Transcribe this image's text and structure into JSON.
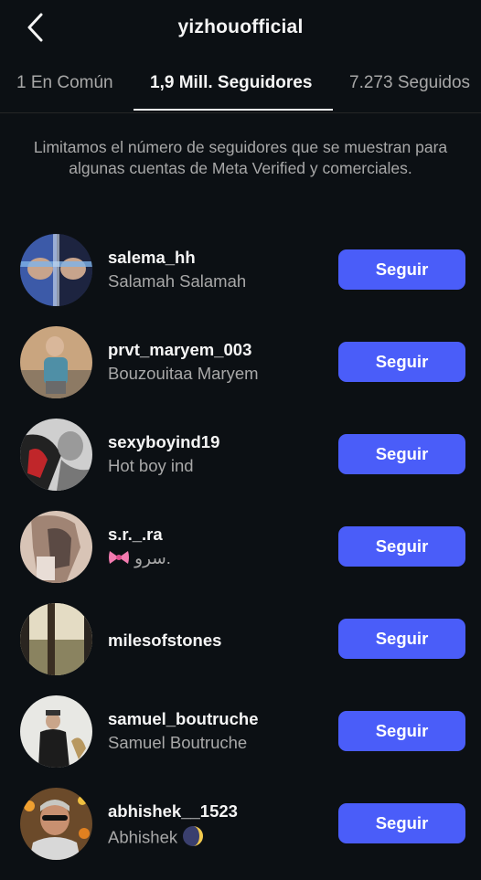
{
  "header": {
    "title": "yizhouofficial",
    "back_icon": "chevron-left-icon"
  },
  "tabs": [
    {
      "label": "1 En Común",
      "active": false
    },
    {
      "label": "1,9 Mill. Seguidores",
      "active": true
    },
    {
      "label": "7.273 Seguidos",
      "active": false
    }
  ],
  "notice": "Limitamos el número de seguidores que se muestran para algunas cuentas de Meta Verified y comerciales.",
  "followers": [
    {
      "username": "salema_hh",
      "full_name": "Salamah Salamah",
      "button": "Seguir"
    },
    {
      "username": "prvt_maryem_003",
      "full_name": "Bouzouitaa Maryem",
      "button": "Seguir"
    },
    {
      "username": "sexyboyind19",
      "full_name": "Hot boy ind",
      "button": "Seguir"
    },
    {
      "username": "s.r._.ra",
      "full_name": "سرو.",
      "full_name_emoji": "ribbon-icon",
      "button": "Seguir"
    },
    {
      "username": "milesofstones",
      "full_name": "",
      "button": "Seguir"
    },
    {
      "username": "samuel_boutruche",
      "full_name": "Samuel Boutruche",
      "button": "Seguir"
    },
    {
      "username": "abhishek__1523",
      "full_name": "Abhishek",
      "full_name_emoji": "moon-icon",
      "button": "Seguir"
    }
  ],
  "colors": {
    "background": "#0c1014",
    "button": "#4a5df9",
    "secondary_text": "#a8a8a8"
  }
}
